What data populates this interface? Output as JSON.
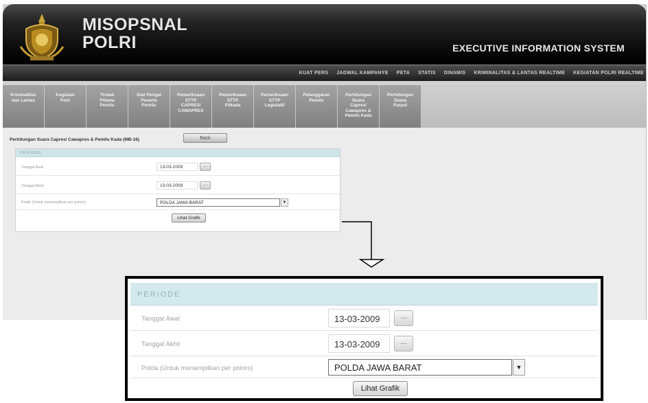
{
  "header": {
    "brand_line1": "MISOPSNAL",
    "brand_line2": "POLRI",
    "system_title": "EXECUTIVE INFORMATION SYSTEM"
  },
  "top_nav": {
    "items": [
      "KUAT PERS",
      "JADWAL KAMPANYE",
      "PETA",
      "STATIS",
      "DINAMIS",
      "KRIMINALITAS & LANTAS REALTIME",
      "KEGIATAN POLRI REALTIME"
    ]
  },
  "sub_nav": {
    "items": [
      "Kriminalitas\ndan Lantas",
      "Kegiatan\nPolri",
      "Tindak\nPidana\nPemilu",
      "Giat Pengat\nPeserta\nPemilu",
      "Pemeriksaan\nSTTP\nCAPRES/\nCAWAPRES",
      "Pemeriksaan\nSTTP\nPilkada",
      "Pemeriksaan\nSTTP\nLegislatif",
      "Pelanggaran\nPemilu",
      "Perhitungan\nSuara\nCapres/\nCawapres &\nPemilu Kada",
      "Perhitungan\nSuara\nParpol"
    ]
  },
  "content": {
    "page_title": "Perhitungan Suara Capres/ Cawapres & Pemilu Kada (MB-16)",
    "back_label": "Back"
  },
  "form": {
    "section_title": "PERIODE",
    "tanggal_awal_label": "Tanggal Awal",
    "tanggal_awal_value": "13-03-2009",
    "tanggal_akhir_label": "Tanggal Akhir",
    "tanggal_akhir_value": "13-03-2009",
    "polda_label": "Polda (Untuk menampilkan per polres)",
    "polda_value": "POLDA JAWA BARAT",
    "date_button_label": "...",
    "select_arrow": "▼",
    "submit_label": "Lihat Grafik"
  },
  "colors": {
    "header_dark": "#0a0a0a",
    "panel_header": "#cfe5ea",
    "subnav_tab": "#8f8f8f"
  }
}
